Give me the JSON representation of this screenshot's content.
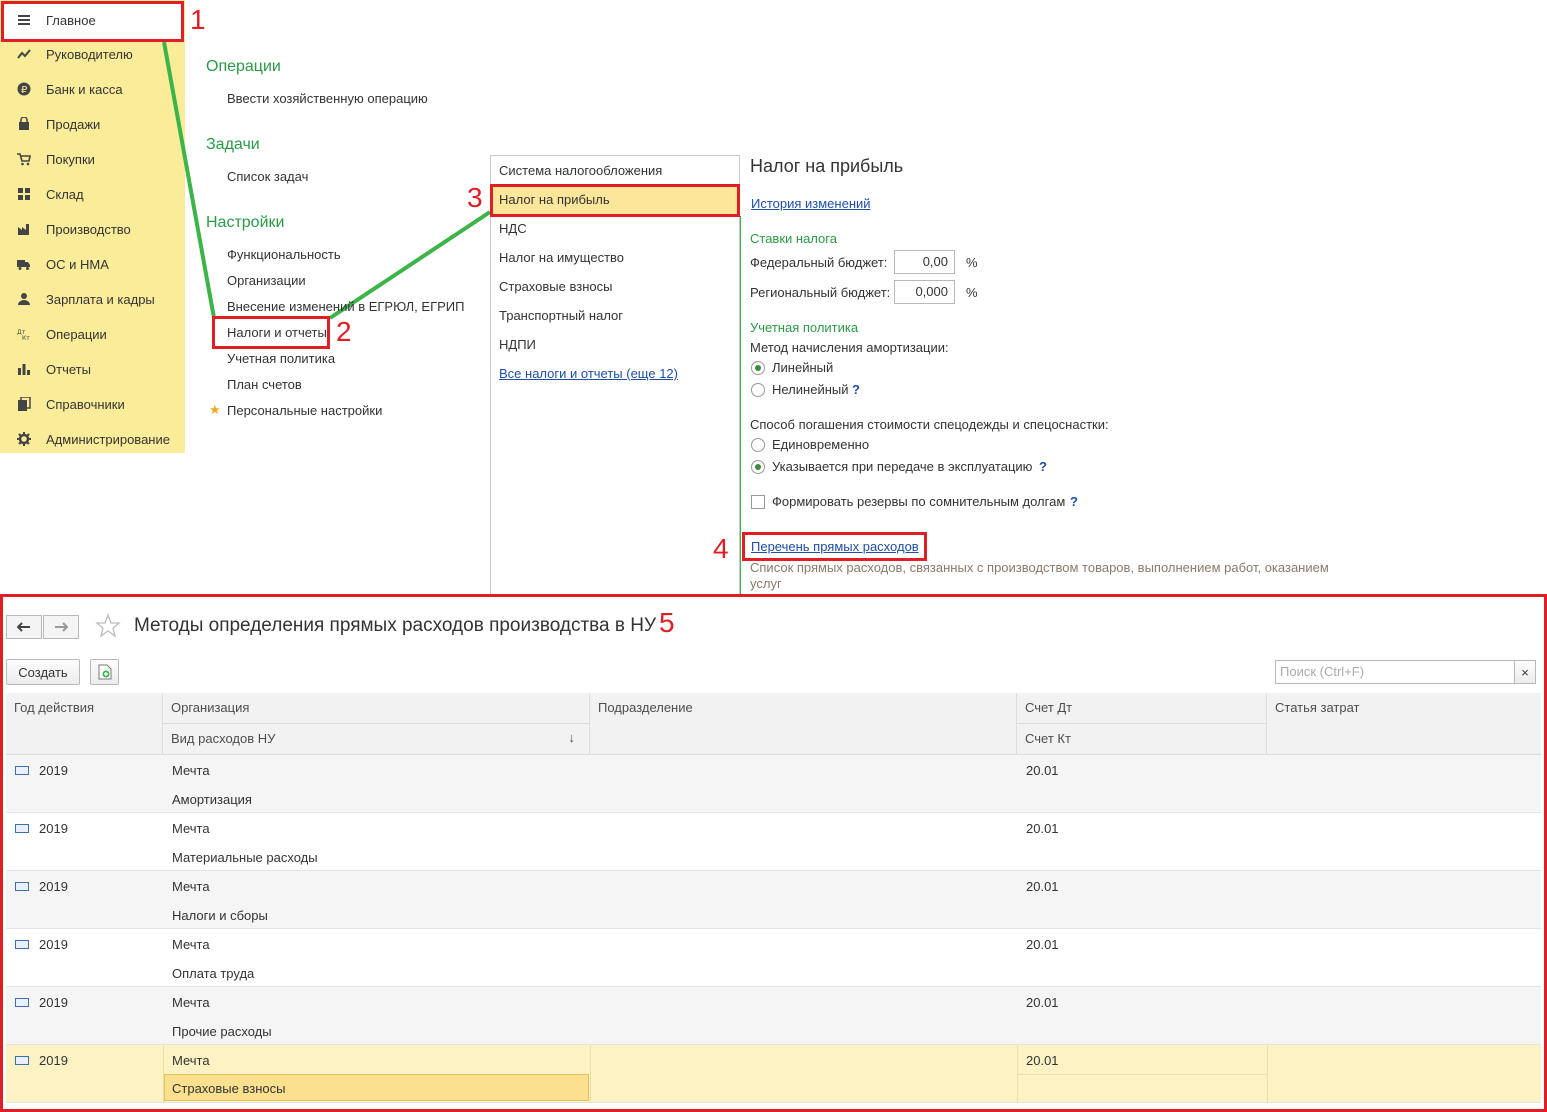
{
  "sidebar": {
    "items": [
      {
        "label": "Главное",
        "icon": "hamburger-icon"
      },
      {
        "label": "Руководителю",
        "icon": "trend-icon"
      },
      {
        "label": "Банк и касса",
        "icon": "ruble-icon"
      },
      {
        "label": "Продажи",
        "icon": "bag-icon"
      },
      {
        "label": "Покупки",
        "icon": "cart-icon"
      },
      {
        "label": "Склад",
        "icon": "grid-icon"
      },
      {
        "label": "Производство",
        "icon": "factory-icon"
      },
      {
        "label": "ОС и НМА",
        "icon": "truck-icon"
      },
      {
        "label": "Зарплата и кадры",
        "icon": "person-icon"
      },
      {
        "label": "Операции",
        "icon": "dt-kt-icon"
      },
      {
        "label": "Отчеты",
        "icon": "bar-chart-icon"
      },
      {
        "label": "Справочники",
        "icon": "books-icon"
      },
      {
        "label": "Администрирование",
        "icon": "gear-icon"
      }
    ]
  },
  "sections": {
    "operations": {
      "title": "Операции",
      "links": [
        "Ввести хозяйственную операцию"
      ]
    },
    "tasks": {
      "title": "Задачи",
      "links": [
        "Список задач"
      ]
    },
    "settings": {
      "title": "Настройки",
      "links": [
        "Функциональность",
        "Организации",
        "Внесение изменений в ЕГРЮЛ, ЕГРИП",
        "Налоги и отчеты",
        "Учетная политика",
        "План счетов",
        "Персональные настройки"
      ]
    }
  },
  "menu_list": {
    "items": [
      "Система налогообложения",
      "Налог на прибыль",
      "НДС",
      "Налог на имущество",
      "Страховые взносы",
      "Транспортный налог",
      "НДПИ"
    ],
    "all_link": "Все налоги и отчеты (еще 12)"
  },
  "settings_panel": {
    "title": "Налог на прибыль",
    "history_link": "История изменений",
    "rates_header": "Ставки налога",
    "federal_label": "Федеральный бюджет:",
    "federal_value": "0,00",
    "regional_label": "Региональный бюджет:",
    "regional_value": "0,000",
    "percent": "%",
    "policy_header": "Учетная политика",
    "depreciation_label": "Метод начисления амортизации:",
    "linear": "Линейный",
    "nonlinear": "Нелинейный",
    "question": "?",
    "workwear_label": "Способ погашения стоимости спецодежды и спецоснастки:",
    "once": "Единовременно",
    "on_transfer": "Указывается при передаче в эксплуатацию",
    "reserves": "Формировать резервы по сомнительным долгам",
    "direct_costs_link": "Перечень прямых расходов",
    "direct_costs_desc": "Список прямых расходов, связанных с производством товаров, выполнением работ, оказанием услуг"
  },
  "annotations": [
    "1",
    "2",
    "3",
    "4",
    "5"
  ],
  "bottom_window": {
    "title": "Методы определения прямых расходов производства в НУ",
    "create_button": "Создать",
    "search_placeholder": "Поиск (Ctrl+F)",
    "search_clear": "×",
    "columns": {
      "year": "Год действия",
      "org": "Организация",
      "cost_type": "Вид расходов НУ",
      "sort_arrow": "↓",
      "division": "Подразделение",
      "dt": "Счет Дт",
      "kt": "Счет Кт",
      "article": "Статья затрат"
    },
    "rows": [
      {
        "year": "2019",
        "org": "Мечта",
        "cost_type": "Амортизация",
        "dt": "20.01"
      },
      {
        "year": "2019",
        "org": "Мечта",
        "cost_type": "Материальные расходы",
        "dt": "20.01"
      },
      {
        "year": "2019",
        "org": "Мечта",
        "cost_type": "Налоги и сборы",
        "dt": "20.01"
      },
      {
        "year": "2019",
        "org": "Мечта",
        "cost_type": "Оплата труда",
        "dt": "20.01"
      },
      {
        "year": "2019",
        "org": "Мечта",
        "cost_type": "Прочие расходы",
        "dt": "20.01"
      },
      {
        "year": "2019",
        "org": "Мечта",
        "cost_type": "Страховые взносы",
        "dt": "20.01"
      }
    ]
  },
  "colors": {
    "sidebar_bg": "#fbec9a",
    "section_green": "#2a9a46",
    "annotation_red": "#e01e25",
    "link_blue": "#1f4ea8",
    "connector_green": "#3cb44a",
    "selected_row": "#fcf2c4"
  }
}
